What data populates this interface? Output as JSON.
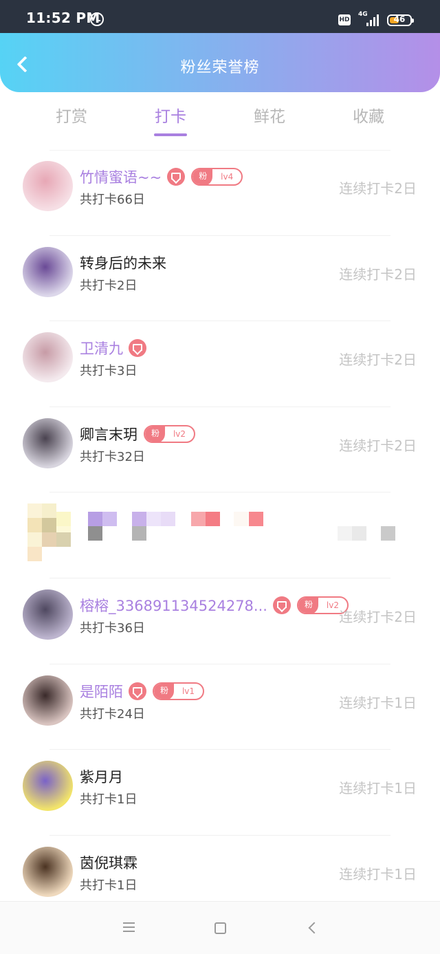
{
  "status_bar": {
    "time": "11:52 PM",
    "hd_label": "HD",
    "network": "4G",
    "battery": "46"
  },
  "colors": {
    "header_gradient_start": "#56d3f5",
    "header_gradient_end": "#b48fe8",
    "accent_purple": "#a980e0",
    "badge_red": "#f07a83",
    "streak_gray": "#c4c4c4"
  },
  "header": {
    "title": "粉丝荣誉榜",
    "back_icon": "chevron-left-icon"
  },
  "tabs": [
    {
      "label": "打赏",
      "active": false
    },
    {
      "label": "打卡",
      "active": true
    },
    {
      "label": "鲜花",
      "active": false
    },
    {
      "label": "收藏",
      "active": false
    }
  ],
  "fans": [
    {
      "name": "竹情蜜语~~",
      "vip": true,
      "gem": true,
      "fan_tag": "粉",
      "fan_level": "lv4",
      "total": "共打卡66日",
      "streak": "连续打卡2日",
      "avatar_colors": [
        "#f6dfe5",
        "#e7a7b5"
      ]
    },
    {
      "name": "转身后的未来",
      "vip": false,
      "gem": false,
      "fan_tag": "",
      "fan_level": "",
      "total": "共打卡2日",
      "streak": "连续打卡2日",
      "avatar_colors": [
        "#dcd7ea",
        "#6a4a96"
      ]
    },
    {
      "name": "卫清九",
      "vip": true,
      "gem": true,
      "fan_tag": "",
      "fan_level": "",
      "total": "共打卡3日",
      "streak": "连续打卡2日",
      "avatar_colors": [
        "#f4eaee",
        "#c79ba6"
      ]
    },
    {
      "name": "卿言末玥",
      "vip": false,
      "gem": false,
      "fan_tag": "粉",
      "fan_level": "lv2",
      "total": "共打卡32日",
      "streak": "连续打卡2日",
      "avatar_colors": [
        "#d8d5df",
        "#4a4350"
      ]
    },
    {
      "name": "",
      "vip": false,
      "gem": false,
      "fan_tag": "",
      "fan_level": "",
      "total": "",
      "streak": "",
      "pixelated": true,
      "avatar_colors": [
        "#f4e8c8",
        "#d8c6a6"
      ]
    },
    {
      "name": "榕榕_336891134524278...",
      "vip": true,
      "gem": true,
      "fan_tag": "粉",
      "fan_level": "lv2",
      "total": "共打卡36日",
      "streak": "连续打卡2日",
      "avatar_colors": [
        "#bdb5cf",
        "#4f4860"
      ]
    },
    {
      "name": "是陌陌",
      "vip": true,
      "gem": true,
      "fan_tag": "粉",
      "fan_level": "lv1",
      "total": "共打卡24日",
      "streak": "连续打卡1日",
      "avatar_colors": [
        "#d9c4c0",
        "#3a2a2a"
      ]
    },
    {
      "name": "紫月月",
      "vip": false,
      "gem": false,
      "fan_tag": "",
      "fan_level": "",
      "total": "共打卡1日",
      "streak": "连续打卡1日",
      "avatar_colors": [
        "#f2e46a",
        "#7a62c8"
      ]
    },
    {
      "name": "茵倪琪霖",
      "vip": false,
      "gem": false,
      "fan_tag": "",
      "fan_level": "",
      "total": "共打卡1日",
      "streak": "连续打卡1日",
      "avatar_colors": [
        "#efd9bd",
        "#4b3322"
      ]
    }
  ],
  "nav_bar": {
    "icons": [
      "menu-icon",
      "home-square-icon",
      "back-triangle-icon"
    ]
  }
}
